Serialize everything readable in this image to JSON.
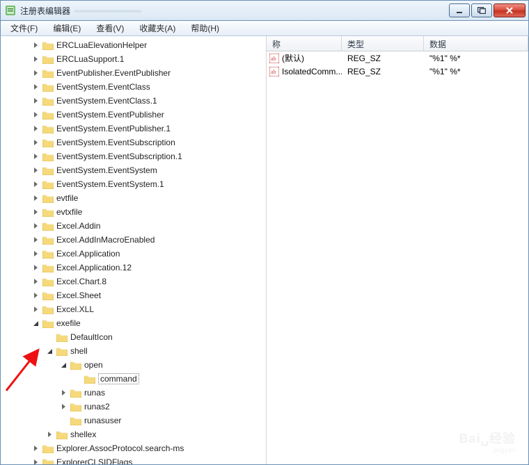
{
  "titlebar": {
    "app_title": "注册表编辑器",
    "document_hint": "————————"
  },
  "menubar": {
    "items": [
      {
        "label": "文件(F)"
      },
      {
        "label": "编辑(E)"
      },
      {
        "label": "查看(V)"
      },
      {
        "label": "收藏夹(A)"
      },
      {
        "label": "帮助(H)"
      }
    ]
  },
  "tree": {
    "nodes": [
      {
        "depth": 3,
        "state": "closed",
        "label": "ERCLuaElevationHelper"
      },
      {
        "depth": 3,
        "state": "closed",
        "label": "ERCLuaSupport.1"
      },
      {
        "depth": 3,
        "state": "closed",
        "label": "EventPublisher.EventPublisher"
      },
      {
        "depth": 3,
        "state": "closed",
        "label": "EventSystem.EventClass"
      },
      {
        "depth": 3,
        "state": "closed",
        "label": "EventSystem.EventClass.1"
      },
      {
        "depth": 3,
        "state": "closed",
        "label": "EventSystem.EventPublisher"
      },
      {
        "depth": 3,
        "state": "closed",
        "label": "EventSystem.EventPublisher.1"
      },
      {
        "depth": 3,
        "state": "closed",
        "label": "EventSystem.EventSubscription"
      },
      {
        "depth": 3,
        "state": "closed",
        "label": "EventSystem.EventSubscription.1"
      },
      {
        "depth": 3,
        "state": "closed",
        "label": "EventSystem.EventSystem"
      },
      {
        "depth": 3,
        "state": "closed",
        "label": "EventSystem.EventSystem.1"
      },
      {
        "depth": 3,
        "state": "closed",
        "label": "evtfile"
      },
      {
        "depth": 3,
        "state": "closed",
        "label": "evtxfile"
      },
      {
        "depth": 3,
        "state": "closed",
        "label": "Excel.Addin"
      },
      {
        "depth": 3,
        "state": "closed",
        "label": "Excel.AddInMacroEnabled"
      },
      {
        "depth": 3,
        "state": "closed",
        "label": "Excel.Application"
      },
      {
        "depth": 3,
        "state": "closed",
        "label": "Excel.Application.12"
      },
      {
        "depth": 3,
        "state": "closed",
        "label": "Excel.Chart.8"
      },
      {
        "depth": 3,
        "state": "closed",
        "label": "Excel.Sheet"
      },
      {
        "depth": 3,
        "state": "closed",
        "label": "Excel.XLL"
      },
      {
        "depth": 3,
        "state": "open",
        "label": "exefile"
      },
      {
        "depth": 4,
        "state": "leaf",
        "label": "DefaultIcon"
      },
      {
        "depth": 4,
        "state": "open",
        "label": "shell"
      },
      {
        "depth": 5,
        "state": "open",
        "label": "open"
      },
      {
        "depth": 6,
        "state": "leaf",
        "label": "command",
        "selected": true
      },
      {
        "depth": 5,
        "state": "closed",
        "label": "runas"
      },
      {
        "depth": 5,
        "state": "closed",
        "label": "runas2"
      },
      {
        "depth": 5,
        "state": "leaf",
        "label": "runasuser"
      },
      {
        "depth": 4,
        "state": "closed",
        "label": "shellex"
      },
      {
        "depth": 3,
        "state": "closed",
        "label": "Explorer.AssocProtocol.search-ms"
      },
      {
        "depth": 3,
        "state": "closed",
        "label": "ExplorerCLSIDFlags"
      }
    ]
  },
  "list": {
    "columns": {
      "name": "称",
      "type": "类型",
      "data": "数据"
    },
    "rows": [
      {
        "name": "(默认)",
        "type": "REG_SZ",
        "data": "\"%1\" %*"
      },
      {
        "name": "IsolatedComm...",
        "type": "REG_SZ",
        "data": "\"%1\" %*"
      }
    ]
  },
  "watermark": {
    "line1": "Bai␣经验",
    "line2": "jingyan"
  }
}
